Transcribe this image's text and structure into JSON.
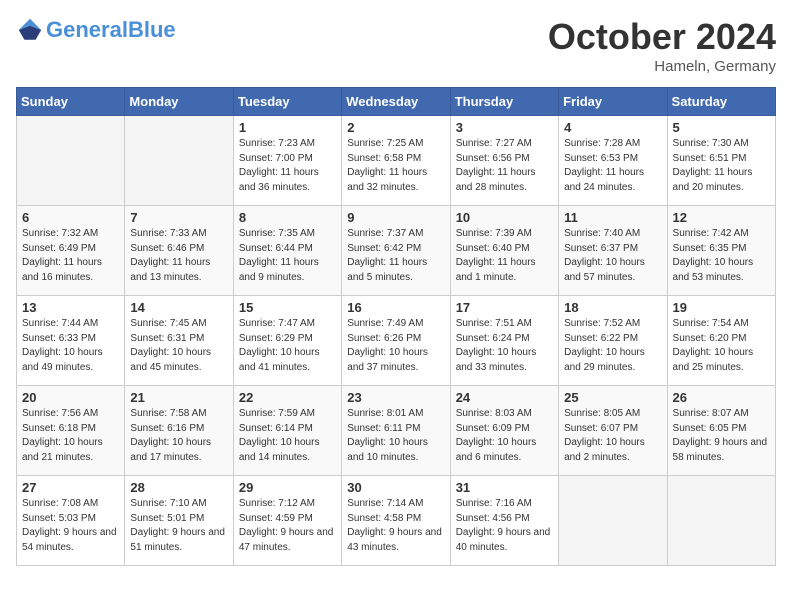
{
  "header": {
    "logo_general": "General",
    "logo_blue": "Blue",
    "month": "October 2024",
    "location": "Hameln, Germany"
  },
  "weekdays": [
    "Sunday",
    "Monday",
    "Tuesday",
    "Wednesday",
    "Thursday",
    "Friday",
    "Saturday"
  ],
  "weeks": [
    [
      {
        "day": "",
        "sunrise": "",
        "sunset": "",
        "daylight": ""
      },
      {
        "day": "",
        "sunrise": "",
        "sunset": "",
        "daylight": ""
      },
      {
        "day": "1",
        "sunrise": "Sunrise: 7:23 AM",
        "sunset": "Sunset: 7:00 PM",
        "daylight": "Daylight: 11 hours and 36 minutes."
      },
      {
        "day": "2",
        "sunrise": "Sunrise: 7:25 AM",
        "sunset": "Sunset: 6:58 PM",
        "daylight": "Daylight: 11 hours and 32 minutes."
      },
      {
        "day": "3",
        "sunrise": "Sunrise: 7:27 AM",
        "sunset": "Sunset: 6:56 PM",
        "daylight": "Daylight: 11 hours and 28 minutes."
      },
      {
        "day": "4",
        "sunrise": "Sunrise: 7:28 AM",
        "sunset": "Sunset: 6:53 PM",
        "daylight": "Daylight: 11 hours and 24 minutes."
      },
      {
        "day": "5",
        "sunrise": "Sunrise: 7:30 AM",
        "sunset": "Sunset: 6:51 PM",
        "daylight": "Daylight: 11 hours and 20 minutes."
      }
    ],
    [
      {
        "day": "6",
        "sunrise": "Sunrise: 7:32 AM",
        "sunset": "Sunset: 6:49 PM",
        "daylight": "Daylight: 11 hours and 16 minutes."
      },
      {
        "day": "7",
        "sunrise": "Sunrise: 7:33 AM",
        "sunset": "Sunset: 6:46 PM",
        "daylight": "Daylight: 11 hours and 13 minutes."
      },
      {
        "day": "8",
        "sunrise": "Sunrise: 7:35 AM",
        "sunset": "Sunset: 6:44 PM",
        "daylight": "Daylight: 11 hours and 9 minutes."
      },
      {
        "day": "9",
        "sunrise": "Sunrise: 7:37 AM",
        "sunset": "Sunset: 6:42 PM",
        "daylight": "Daylight: 11 hours and 5 minutes."
      },
      {
        "day": "10",
        "sunrise": "Sunrise: 7:39 AM",
        "sunset": "Sunset: 6:40 PM",
        "daylight": "Daylight: 11 hours and 1 minute."
      },
      {
        "day": "11",
        "sunrise": "Sunrise: 7:40 AM",
        "sunset": "Sunset: 6:37 PM",
        "daylight": "Daylight: 10 hours and 57 minutes."
      },
      {
        "day": "12",
        "sunrise": "Sunrise: 7:42 AM",
        "sunset": "Sunset: 6:35 PM",
        "daylight": "Daylight: 10 hours and 53 minutes."
      }
    ],
    [
      {
        "day": "13",
        "sunrise": "Sunrise: 7:44 AM",
        "sunset": "Sunset: 6:33 PM",
        "daylight": "Daylight: 10 hours and 49 minutes."
      },
      {
        "day": "14",
        "sunrise": "Sunrise: 7:45 AM",
        "sunset": "Sunset: 6:31 PM",
        "daylight": "Daylight: 10 hours and 45 minutes."
      },
      {
        "day": "15",
        "sunrise": "Sunrise: 7:47 AM",
        "sunset": "Sunset: 6:29 PM",
        "daylight": "Daylight: 10 hours and 41 minutes."
      },
      {
        "day": "16",
        "sunrise": "Sunrise: 7:49 AM",
        "sunset": "Sunset: 6:26 PM",
        "daylight": "Daylight: 10 hours and 37 minutes."
      },
      {
        "day": "17",
        "sunrise": "Sunrise: 7:51 AM",
        "sunset": "Sunset: 6:24 PM",
        "daylight": "Daylight: 10 hours and 33 minutes."
      },
      {
        "day": "18",
        "sunrise": "Sunrise: 7:52 AM",
        "sunset": "Sunset: 6:22 PM",
        "daylight": "Daylight: 10 hours and 29 minutes."
      },
      {
        "day": "19",
        "sunrise": "Sunrise: 7:54 AM",
        "sunset": "Sunset: 6:20 PM",
        "daylight": "Daylight: 10 hours and 25 minutes."
      }
    ],
    [
      {
        "day": "20",
        "sunrise": "Sunrise: 7:56 AM",
        "sunset": "Sunset: 6:18 PM",
        "daylight": "Daylight: 10 hours and 21 minutes."
      },
      {
        "day": "21",
        "sunrise": "Sunrise: 7:58 AM",
        "sunset": "Sunset: 6:16 PM",
        "daylight": "Daylight: 10 hours and 17 minutes."
      },
      {
        "day": "22",
        "sunrise": "Sunrise: 7:59 AM",
        "sunset": "Sunset: 6:14 PM",
        "daylight": "Daylight: 10 hours and 14 minutes."
      },
      {
        "day": "23",
        "sunrise": "Sunrise: 8:01 AM",
        "sunset": "Sunset: 6:11 PM",
        "daylight": "Daylight: 10 hours and 10 minutes."
      },
      {
        "day": "24",
        "sunrise": "Sunrise: 8:03 AM",
        "sunset": "Sunset: 6:09 PM",
        "daylight": "Daylight: 10 hours and 6 minutes."
      },
      {
        "day": "25",
        "sunrise": "Sunrise: 8:05 AM",
        "sunset": "Sunset: 6:07 PM",
        "daylight": "Daylight: 10 hours and 2 minutes."
      },
      {
        "day": "26",
        "sunrise": "Sunrise: 8:07 AM",
        "sunset": "Sunset: 6:05 PM",
        "daylight": "Daylight: 9 hours and 58 minutes."
      }
    ],
    [
      {
        "day": "27",
        "sunrise": "Sunrise: 7:08 AM",
        "sunset": "Sunset: 5:03 PM",
        "daylight": "Daylight: 9 hours and 54 minutes."
      },
      {
        "day": "28",
        "sunrise": "Sunrise: 7:10 AM",
        "sunset": "Sunset: 5:01 PM",
        "daylight": "Daylight: 9 hours and 51 minutes."
      },
      {
        "day": "29",
        "sunrise": "Sunrise: 7:12 AM",
        "sunset": "Sunset: 4:59 PM",
        "daylight": "Daylight: 9 hours and 47 minutes."
      },
      {
        "day": "30",
        "sunrise": "Sunrise: 7:14 AM",
        "sunset": "Sunset: 4:58 PM",
        "daylight": "Daylight: 9 hours and 43 minutes."
      },
      {
        "day": "31",
        "sunrise": "Sunrise: 7:16 AM",
        "sunset": "Sunset: 4:56 PM",
        "daylight": "Daylight: 9 hours and 40 minutes."
      },
      {
        "day": "",
        "sunrise": "",
        "sunset": "",
        "daylight": ""
      },
      {
        "day": "",
        "sunrise": "",
        "sunset": "",
        "daylight": ""
      }
    ]
  ]
}
